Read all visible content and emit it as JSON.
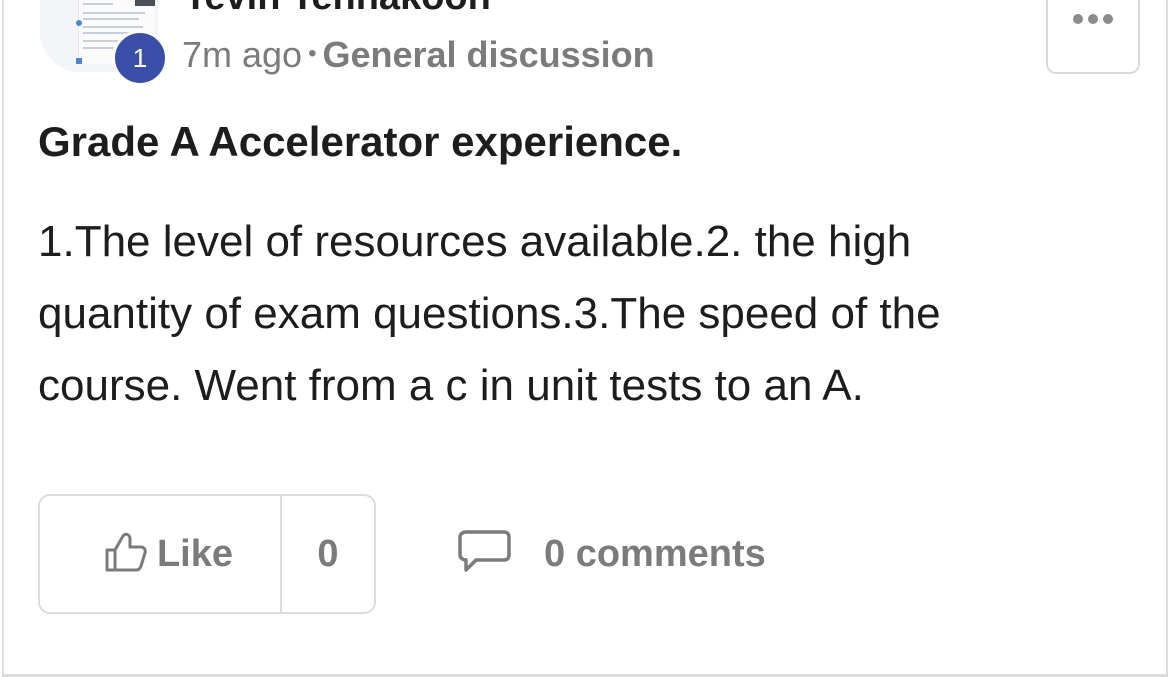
{
  "author": {
    "name": "Tevin Tennakoon",
    "badge_count": "1"
  },
  "meta": {
    "time_ago": "7m ago",
    "separator": "•",
    "category": "General discussion"
  },
  "post": {
    "title": "Grade A Accelerator experience.",
    "body": "1.The level of resources available.2. the high quantity of exam questions.3.The speed of the course. Went from a c in unit tests to an A."
  },
  "actions": {
    "like_label": "Like",
    "like_count": "0",
    "comments_label": "0 comments"
  },
  "icons": {
    "more": "more-horizontal-icon",
    "like": "thumbs-up-icon",
    "comment": "comment-bubble-icon"
  },
  "colors": {
    "badge": "#3c4fa8",
    "muted_text": "#7a7b7d",
    "text": "#1c1d1f",
    "border": "#dcdcdc"
  }
}
